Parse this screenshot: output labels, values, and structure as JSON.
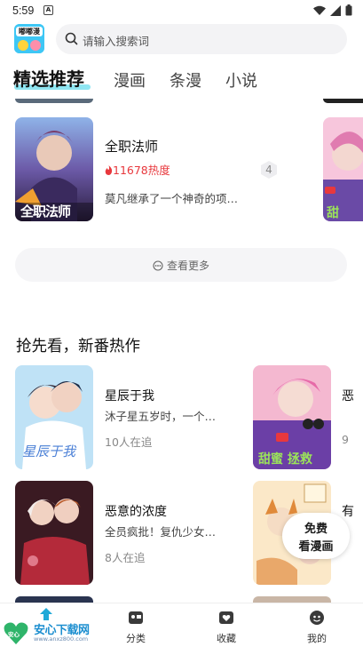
{
  "status_bar": {
    "time": "5:59",
    "notification_glyph": "A"
  },
  "header": {
    "logo_text": "嘟嘟漫",
    "search": {
      "placeholder": "请输入搜索词"
    }
  },
  "tabs": [
    {
      "label": "精选推荐",
      "active": true
    },
    {
      "label": "漫画",
      "active": false
    },
    {
      "label": "条漫",
      "active": false
    },
    {
      "label": "小说",
      "active": false
    }
  ],
  "ranking": {
    "items": [
      {
        "title": "全职法师",
        "heat": "11678热度",
        "rank": "4",
        "desc": "莫凡继承了一个神奇的项…",
        "cover_text": "全职法师"
      }
    ],
    "more_label": "查看更多"
  },
  "new_section": {
    "title": "抢先看，新番热作",
    "items": [
      {
        "title": "星辰于我",
        "desc": "沐子星五岁时，一个…",
        "followers": "10人在追",
        "cover_text": "星辰于我"
      },
      {
        "title": "恶意的浓度",
        "desc": "全员疯批！复仇少女…",
        "followers": "8人在追",
        "cover_text": ""
      }
    ],
    "right_items": [
      {
        "title_partial": "恶",
        "meta_partial": "9"
      },
      {
        "title_partial": "有",
        "meta_partial": ""
      }
    ],
    "float_badge": {
      "line1": "免费",
      "line2": "看漫画"
    }
  },
  "bottom_nav": [
    {
      "label": "分类",
      "icon": "category-icon"
    },
    {
      "label": "收藏",
      "icon": "favorite-icon"
    },
    {
      "label": "我的",
      "icon": "profile-icon"
    }
  ],
  "watermark": {
    "brand": "安心下载网",
    "url": "www.anxz800.com",
    "badge": "安心"
  },
  "colors": {
    "accent": "#8fe6f2",
    "heat": "#e8383d",
    "search_bg": "#f3f3f5"
  }
}
